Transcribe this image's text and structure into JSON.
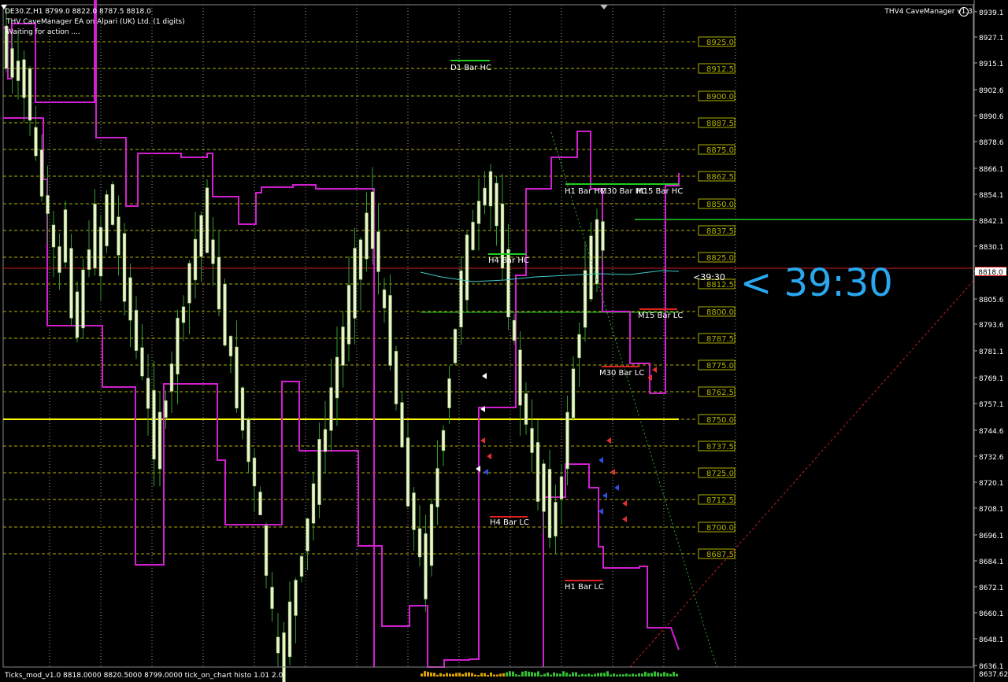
{
  "header": {
    "symbol_line": "DE30.Z,H1  8799.0 8822.0 8787.5 8818.0",
    "ea_line": "THV CaveManager EA on Alpari (UK) Ltd. (1 digits)",
    "status_line": "Waiting for action ....",
    "ea_title": "THV4 CaveManager v1.3"
  },
  "footer": {
    "indicator_line": "Ticks_mod_v1.0 8818.0000 8820.5000 8799.0000  tick_on_chart histo 1.01 2.0"
  },
  "countdown": {
    "big": "<    39:30",
    "small": "<39:30"
  },
  "price_axis": {
    "labels": [
      "8939.1",
      "8927.1",
      "8915.1",
      "8902.6",
      "8890.6",
      "8878.6",
      "8866.1",
      "8854.1",
      "8842.1",
      "8830.1",
      "8818.0",
      "8805.6",
      "8793.6",
      "8781.1",
      "8769.1",
      "8757.1",
      "8744.6",
      "8732.6",
      "8720.1",
      "8708.1",
      "8696.1",
      "8684.1",
      "8672.1",
      "8660.1",
      "8648.1",
      "8636.1"
    ],
    "current_price": "8818.0",
    "bottom_label": "8637.62"
  },
  "level_lines": {
    "labels": [
      "8925.0",
      "8912.5",
      "8900.0",
      "8887.5",
      "8875.0",
      "8862.5",
      "8850.0",
      "8837.5",
      "8825.0",
      "8812.5",
      "8800.0",
      "8787.5",
      "8775.0",
      "8762.5",
      "8750.0",
      "8737.5",
      "8725.0",
      "8712.5",
      "8700.0",
      "8687.5"
    ]
  },
  "bar_labels": [
    {
      "text": "D1 Bar HC"
    },
    {
      "text": "H1 Bar HC"
    },
    {
      "text": "M30 Bar HC"
    },
    {
      "text": "M15 Bar HC"
    },
    {
      "text": "H4 Bar HC"
    },
    {
      "text": "M15 Bar LC"
    },
    {
      "text": "M30 Bar LC"
    },
    {
      "text": "H4 Bar LC"
    },
    {
      "text": "H1 Bar LC"
    }
  ],
  "colors": {
    "background": "#000000",
    "candle_up": "#e8f5c8",
    "candle_wick": "#2f9e2f",
    "envelope": "#d020d0",
    "level_line": "#b0b000",
    "yellow_line": "#ffff00",
    "hc_line": "#22cc22",
    "lc_line": "#dd2020",
    "countdown": "#2aa7ee"
  }
}
